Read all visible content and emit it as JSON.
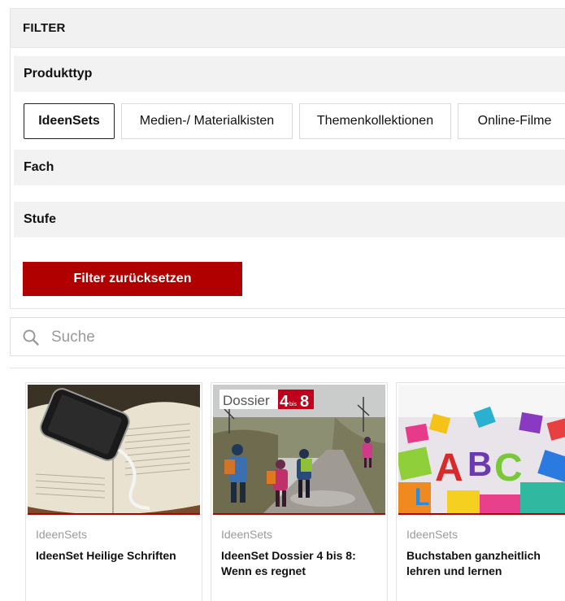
{
  "filter": {
    "header": "FILTER",
    "sections": {
      "produkttyp": "Produkttyp",
      "fach": "Fach",
      "stufe": "Stufe"
    },
    "chips": [
      {
        "label": "IdeenSets",
        "active": true
      },
      {
        "label": "Medien-/ Materialkisten",
        "active": false
      },
      {
        "label": "Themenkollektionen",
        "active": false
      },
      {
        "label": "Online-Filme",
        "active": false
      }
    ],
    "reset_label": "Filter zurücksetzen",
    "accent_color": "#b00000"
  },
  "search": {
    "placeholder": "Suche",
    "icon": "search-icon"
  },
  "results": [
    {
      "category": "IdeenSets",
      "title": "IdeenSet Heilige Schriften",
      "image": "phone-on-bible"
    },
    {
      "category": "IdeenSets",
      "title": "IdeenSet Dossier 4 bis 8: Wenn es regnet",
      "image": "children-in-rain",
      "badge": {
        "word": "Dossier",
        "num1": "4",
        "small": "bis",
        "num2": "8"
      }
    },
    {
      "category": "IdeenSets",
      "title": "Buchstaben ganzheitlich lehren und lernen",
      "image": "colorful-letters"
    }
  ]
}
